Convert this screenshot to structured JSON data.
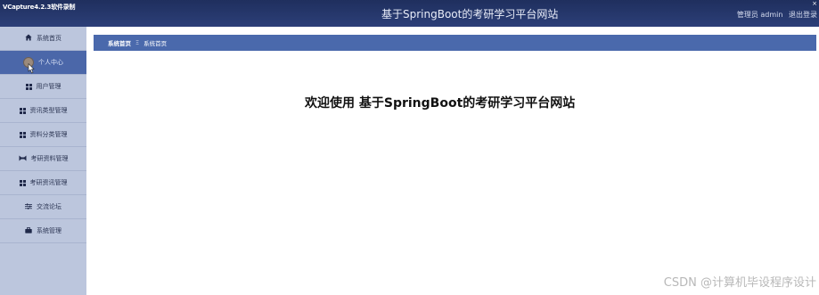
{
  "recorder": {
    "tag": "VCapture4.2.3软件录制"
  },
  "header": {
    "title": "基于SpringBoot的考研学习平台网站",
    "user_role": "管理员 admin",
    "logout_label": "退出登录",
    "window_mark": "×"
  },
  "sidebar": {
    "items": [
      {
        "label": "系统首页",
        "icon": "home-icon"
      },
      {
        "label": "个人中心",
        "icon": "avatar"
      },
      {
        "label": "用户管理",
        "icon": "grid-icon"
      },
      {
        "label": "资讯类型管理",
        "icon": "grid-icon"
      },
      {
        "label": "资料分类管理",
        "icon": "grid-icon"
      },
      {
        "label": "考研资料管理",
        "icon": "hashtag-icon"
      },
      {
        "label": "考研资讯管理",
        "icon": "grid-icon"
      },
      {
        "label": "交流论坛",
        "icon": "sliders-icon"
      },
      {
        "label": "系统管理",
        "icon": "briefcase-icon"
      }
    ],
    "active_index": 1
  },
  "breadcrumb": {
    "first": "系统首页",
    "separator": "Ξ",
    "current": "系统首页"
  },
  "main": {
    "welcome": "欢迎使用 基于SpringBoot的考研学习平台网站"
  },
  "watermark": "CSDN @计算机毕设程序设计",
  "colors": {
    "header": "#24356a",
    "sidebar": "#bcc6dd",
    "sidebar_active": "#4b67a9",
    "breadcrumb_bar": "#4a69ac"
  }
}
